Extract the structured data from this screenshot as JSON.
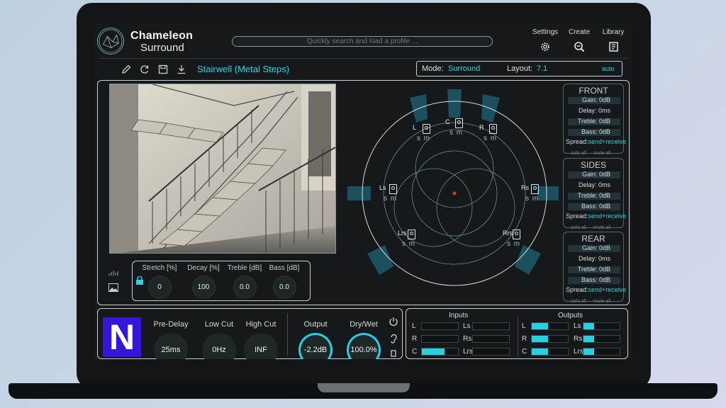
{
  "app": {
    "name_line1": "Chameleon",
    "name_line2": "Surround",
    "search_placeholder": "Quickly search and load a profile ..."
  },
  "header_buttons": [
    {
      "label": "Settings",
      "icon": "gear-icon"
    },
    {
      "label": "Create",
      "icon": "magnify-icon"
    },
    {
      "label": "Library",
      "icon": "library-icon"
    }
  ],
  "toolbar": {
    "profile_name": "Stairwell (Metal Steps)",
    "mode_label": "Mode:",
    "mode_value": "Surround",
    "layout_label": "Layout:",
    "layout_value": "7.1",
    "auto_label": "auto"
  },
  "image_controls": {
    "knobs": [
      {
        "label": "Stretch [%]",
        "value": "0"
      },
      {
        "label": "Decay [%]",
        "value": "100"
      },
      {
        "label": "Treble [dB]",
        "value": "0.0"
      },
      {
        "label": "Bass [dB]",
        "value": "0.0"
      }
    ]
  },
  "speakers": [
    {
      "label": "L"
    },
    {
      "label": "C"
    },
    {
      "label": "R"
    },
    {
      "label": "Ls"
    },
    {
      "label": "Rs"
    },
    {
      "label": "Lrs"
    },
    {
      "label": "Rrs"
    }
  ],
  "speaker_sm": "s m",
  "groups": [
    {
      "title": "FRONT",
      "gain": "Gain: 0dB",
      "delay": "Delay: 0ms",
      "treble": "Treble: 0dB",
      "bass": "Bass: 0dB",
      "spread_label": "Spread:",
      "spread_value": "send+receive",
      "solo": "solo all",
      "mute": "mute all"
    },
    {
      "title": "SIDES",
      "gain": "Gain: 0dB",
      "delay": "Delay: 0ms",
      "treble": "Treble: 0dB",
      "bass": "Bass: 0dB",
      "spread_label": "Spread:",
      "spread_value": "send+receive",
      "solo": "solo all",
      "mute": "mute all"
    },
    {
      "title": "REAR",
      "gain": "Gain: 0dB",
      "delay": "Delay: 0ms",
      "treble": "Treble: 0dB",
      "bass": "Bass: 0dB",
      "spread_label": "Spread:",
      "spread_value": "send+receive",
      "solo": "solo all",
      "mute": "mute all"
    }
  ],
  "bottom_left": {
    "logo_letter": "N",
    "knobs": [
      {
        "label": "Pre-Delay",
        "value": "25ms"
      },
      {
        "label": "Low Cut",
        "value": "0Hz"
      },
      {
        "label": "High Cut",
        "value": "INF"
      },
      {
        "label": "Output",
        "value": "-2.2dB"
      },
      {
        "label": "Dry/Wet",
        "value": "100.0%"
      }
    ]
  },
  "meters": {
    "inputs_title": "Inputs",
    "outputs_title": "Outputs",
    "inputs": [
      {
        "label": "L",
        "level": 0.0
      },
      {
        "label": "Ls",
        "level": 0.0
      },
      {
        "label": "R",
        "level": 0.0
      },
      {
        "label": "Rs",
        "level": 0.0
      },
      {
        "label": "C",
        "level": 0.62
      },
      {
        "label": "Lrs",
        "level": 0.0
      }
    ],
    "outputs": [
      {
        "label": "L",
        "level": 0.45
      },
      {
        "label": "Ls",
        "level": 0.3
      },
      {
        "label": "R",
        "level": 0.45
      },
      {
        "label": "Rs",
        "level": 0.3
      },
      {
        "label": "C",
        "level": 0.45
      },
      {
        "label": "Lrs",
        "level": 0.3
      }
    ]
  },
  "colors": {
    "accent": "#27cfe0",
    "logo_bg": "#3317d9"
  }
}
